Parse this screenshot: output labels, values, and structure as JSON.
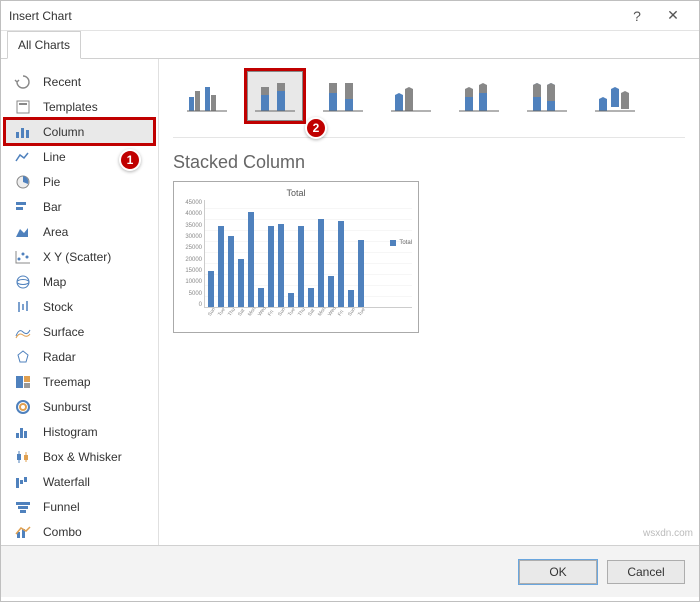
{
  "window": {
    "title": "Insert Chart",
    "help": "?",
    "close": "✕"
  },
  "tabs": {
    "active": "All Charts"
  },
  "sidebar": {
    "items": [
      {
        "label": "Recent"
      },
      {
        "label": "Templates"
      },
      {
        "label": "Column",
        "selected": true
      },
      {
        "label": "Line"
      },
      {
        "label": "Pie"
      },
      {
        "label": "Bar"
      },
      {
        "label": "Area"
      },
      {
        "label": "X Y (Scatter)"
      },
      {
        "label": "Map"
      },
      {
        "label": "Stock"
      },
      {
        "label": "Surface"
      },
      {
        "label": "Radar"
      },
      {
        "label": "Treemap"
      },
      {
        "label": "Sunburst"
      },
      {
        "label": "Histogram"
      },
      {
        "label": "Box & Whisker"
      },
      {
        "label": "Waterfall"
      },
      {
        "label": "Funnel"
      },
      {
        "label": "Combo"
      }
    ]
  },
  "content": {
    "heading": "Stacked Column",
    "preview_title": "Total",
    "legend": "Total"
  },
  "footer": {
    "ok": "OK",
    "cancel": "Cancel"
  },
  "markers": {
    "one": "1",
    "two": "2"
  },
  "watermark": "wsxdn.com",
  "chart_data": {
    "type": "bar",
    "title": "Total",
    "ylabel": "",
    "xlabel": "",
    "ylim": [
      0,
      45000
    ],
    "y_ticks": [
      0,
      5000,
      10000,
      15000,
      20000,
      25000,
      30000,
      35000,
      40000,
      45000
    ],
    "categories": [
      "Sun",
      "Tue",
      "Thu",
      "Sat",
      "Mon",
      "Wed",
      "Fri",
      "Sun",
      "Tue",
      "Thu",
      "Sat",
      "Mon",
      "Wed",
      "Fri",
      "Sun",
      "Tue"
    ],
    "values": [
      15000,
      34000,
      30000,
      20000,
      40000,
      8000,
      34000,
      35000,
      6000,
      34000,
      8000,
      37000,
      13000,
      36000,
      7000,
      28000
    ],
    "series": [
      {
        "name": "Total"
      }
    ]
  }
}
